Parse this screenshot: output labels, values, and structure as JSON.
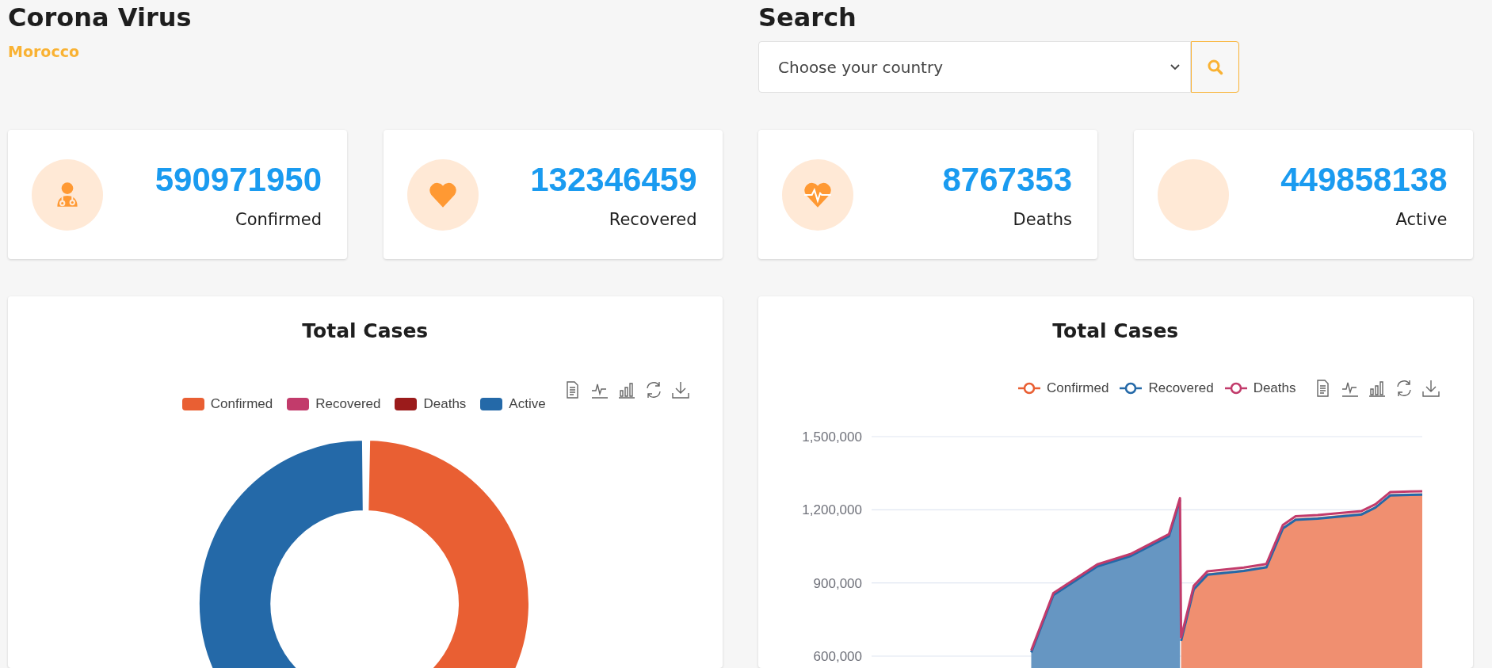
{
  "header": {
    "title": "Corona Virus",
    "country": "Morocco"
  },
  "search": {
    "title": "Search",
    "value": "Choose your country"
  },
  "stats": [
    {
      "kind": "doctor",
      "value": "590971950",
      "label": "Confirmed"
    },
    {
      "kind": "heart",
      "value": "132346459",
      "label": "Recovered"
    },
    {
      "kind": "heartbeat",
      "value": "8767353",
      "label": "Deaths"
    },
    {
      "kind": "blank",
      "value": "449858138",
      "label": "Active"
    }
  ],
  "donut_chart": {
    "title": "Total Cases",
    "legend": [
      {
        "label": "Confirmed",
        "color": "#e95f33"
      },
      {
        "label": "Recovered",
        "color": "#c23b6b"
      },
      {
        "label": "Deaths",
        "color": "#9b1b1b"
      },
      {
        "label": "Active",
        "color": "#2469a8"
      }
    ]
  },
  "line_chart": {
    "title": "Total Cases",
    "legend": [
      {
        "label": "Confirmed",
        "color": "#e95f33"
      },
      {
        "label": "Recovered",
        "color": "#2469a8"
      },
      {
        "label": "Deaths",
        "color": "#c23b6b"
      }
    ],
    "y_axis_labels": [
      "1,500,000",
      "1,200,000",
      "900,000",
      "600,000"
    ]
  }
}
